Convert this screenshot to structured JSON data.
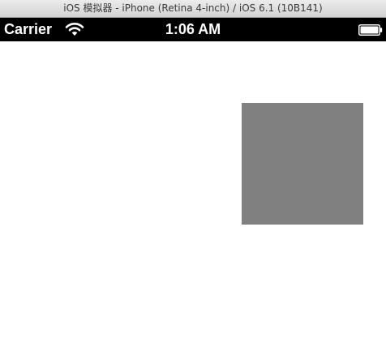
{
  "window": {
    "title": "iOS 模拟器 - iPhone (Retina 4-inch) / iOS 6.1 (10B141)"
  },
  "status_bar": {
    "carrier": "Carrier",
    "time": "1:06 AM",
    "wifi_icon": "wifi-icon",
    "battery_icon": "battery-full-icon",
    "battery_level_percent": 100
  },
  "content": {
    "square_color": "#808080",
    "background_color": "#ffffff"
  }
}
